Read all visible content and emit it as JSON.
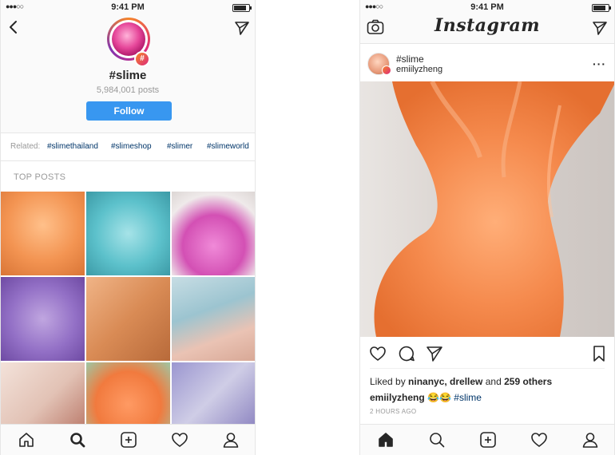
{
  "status": {
    "signal": "●●●○○",
    "time": "9:41 PM"
  },
  "hashtag_page": {
    "title": "#slime",
    "post_count": "5,984,001 posts",
    "follow_label": "Follow",
    "related_label": "Related:",
    "related_tags": [
      "#slimethailand",
      "#slimeshop",
      "#slimer",
      "#slimeworld"
    ],
    "top_posts_label": "TOP POSTS",
    "grid_colors": [
      [
        "#f3a06a",
        "#7fd0d6",
        "#d86bc0"
      ],
      [
        "#9f7dc6",
        "#dd9a67",
        "#a7c7d1"
      ],
      [
        "#e9d0c6",
        "#f08a5a",
        "#8a86c4"
      ]
    ],
    "nav_icons": [
      "home-icon",
      "search-icon",
      "add-icon",
      "heart-icon",
      "profile-icon"
    ]
  },
  "feed_post": {
    "app_title": "Instagram",
    "hashtag": "#slime",
    "username": "emiilyzheng",
    "more": "···",
    "liked_by_prefix": "Liked by ",
    "liked_names": "ninanyc, drellew",
    "liked_and": " and ",
    "liked_others": "259 others",
    "caption_user": "emiilyzheng",
    "caption_emoji": "😂😂",
    "caption_tag": "#slime",
    "time_ago": "2 HOURS AGO",
    "nav_icons": [
      "home-icon",
      "search-icon",
      "add-icon",
      "heart-icon",
      "profile-icon"
    ]
  },
  "colors": {
    "accent": "#3897f0",
    "link": "#003569",
    "muted": "#999999",
    "gradient_start": "#f58529",
    "gradient_end": "#dd2a7b"
  }
}
